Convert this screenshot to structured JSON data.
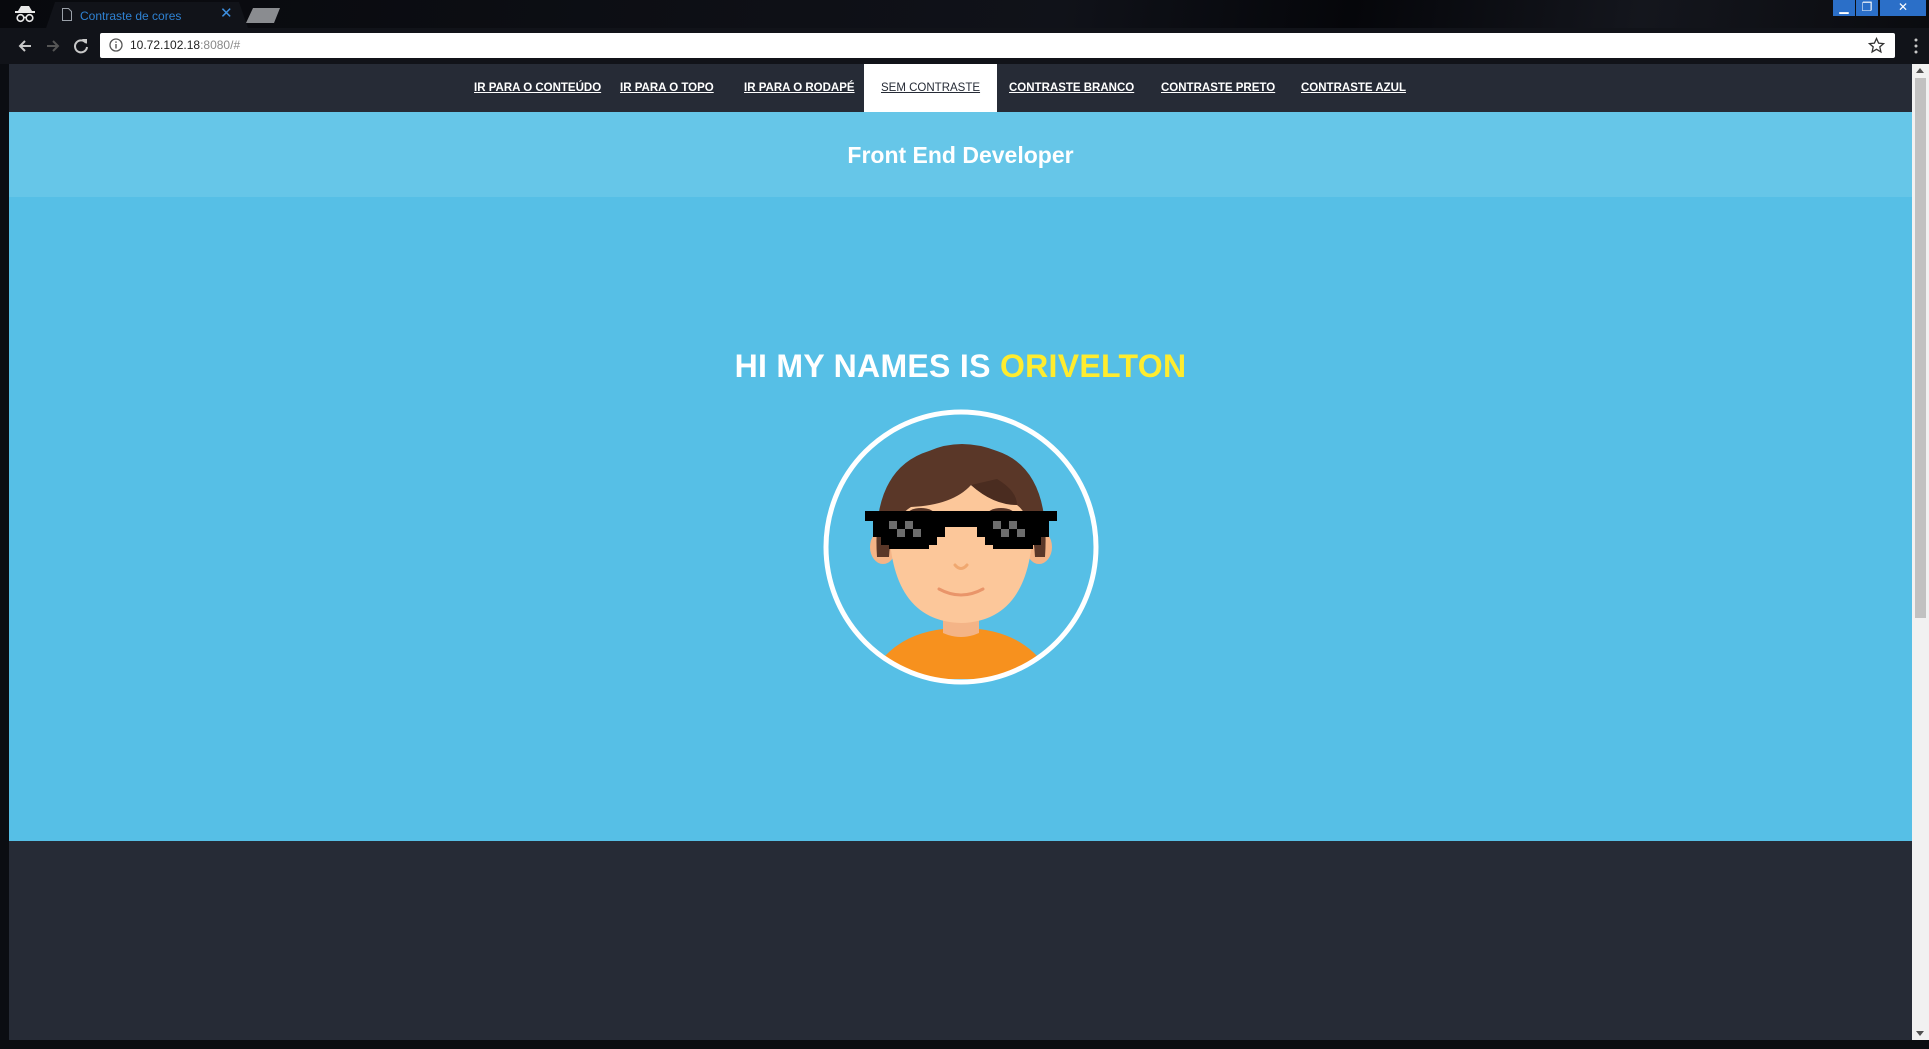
{
  "browser": {
    "tab_title": "Contraste de cores",
    "tab_close": "✕",
    "url_host": "10.72.102.18",
    "url_rest": ":8080/#",
    "minimize": "▁",
    "restore": "❐",
    "close": "✕"
  },
  "nav": {
    "items": [
      {
        "label": "IR PARA O CONTEÚDO"
      },
      {
        "label": "IR PARA O TOPO"
      },
      {
        "label": "IR PARA O RODAPÉ"
      },
      {
        "label": "SEM CONTRASTE"
      },
      {
        "label": "CONTRASTE BRANCO"
      },
      {
        "label": "CONTRASTE PRETO"
      },
      {
        "label": "CONTRASTE AZUL"
      }
    ],
    "active": "SEM CONTRASTE"
  },
  "header": {
    "brand": "Front End Developer"
  },
  "hero": {
    "greeting": "HI MY NAMES IS",
    "name": "ORIVELTON"
  },
  "colors": {
    "nav_bg": "#262b36",
    "header_bg": "#66c6e8",
    "hero_bg": "#56bfe6",
    "name_accent": "#ffec2e",
    "shirt": "#f7911e",
    "hair": "#5a3728",
    "skin": "#fcc79a"
  }
}
